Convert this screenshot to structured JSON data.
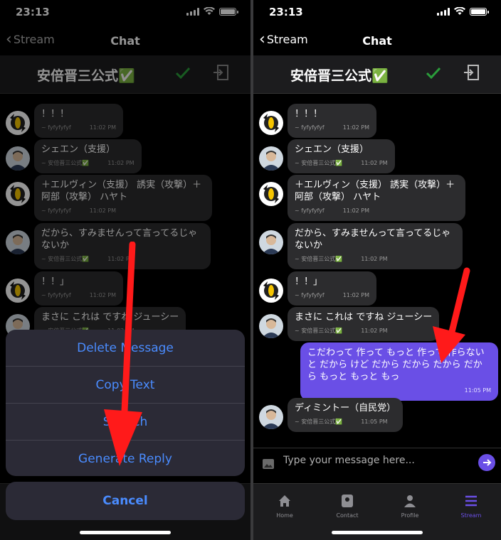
{
  "status": {
    "time": "23:13"
  },
  "nav": {
    "back_label": "Stream",
    "title": "Chat"
  },
  "chat": {
    "name": "安倍晋三公式✅"
  },
  "messages": [
    {
      "text": "！！！",
      "sender": "~ fyfyfyfyf",
      "time": "11:02 PM"
    },
    {
      "text": "シェエン（支援）",
      "sender": "~ 安倍晋三公式✅",
      "time": "11:02 PM"
    },
    {
      "text": "＋エルヴィン（支援） 誘実（攻撃）＋阿部（攻撃） ハヤト",
      "sender": "~ fyfyfyfyf",
      "time": "11:02 PM"
    },
    {
      "text": "だから、すみませんって言ってるじゃないか",
      "sender": "~ 安倍晋三公式✅",
      "time": "11:02 PM"
    },
    {
      "text": "！！」",
      "sender": "~ fyfyfyfyf",
      "time": "11:02 PM"
    },
    {
      "text": "まさに これは ですね ジューシー",
      "sender": "~ 安倍晋三公式✅",
      "time": "11:02 PM"
    },
    {
      "text": "こだわって 作って もっと 作って 作らないと だから けど だから だから だから だから もっと もっと もっ",
      "time": "11:05 PM"
    },
    {
      "text": "ディミントー（自民党）",
      "sender": "~ 安倍晋三公式✅",
      "time": "11:05 PM"
    }
  ],
  "input": {
    "placeholder": "Type your message here..."
  },
  "tabs": [
    {
      "label": "Home",
      "icon": "home-icon"
    },
    {
      "label": "Contact",
      "icon": "contact-card-icon"
    },
    {
      "label": "Profile",
      "icon": "person-icon"
    },
    {
      "label": "Stream",
      "icon": "stream-icon"
    }
  ],
  "action_sheet": {
    "options": [
      "Delete Message",
      "Copy Text",
      "Speech",
      "Generate Reply"
    ],
    "cancel": "Cancel"
  },
  "colors": {
    "accent": "#6a4fe6",
    "sheet_text": "#4a8cff",
    "verified": "#2a9d3a",
    "arrow": "#ff1a1a"
  }
}
